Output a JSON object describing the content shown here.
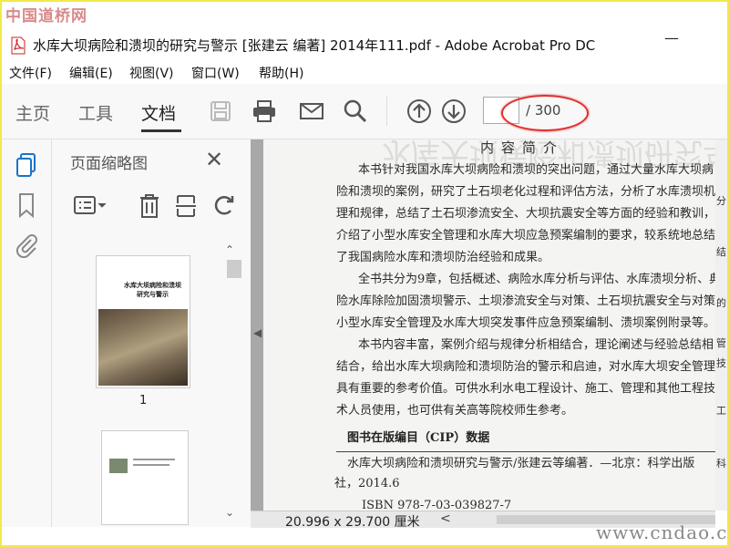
{
  "watermark_top": "中国道桥网",
  "watermark_bottom": "www.cndao.com",
  "window": {
    "title": "水库大坝病险和溃坝的研究与警示 [张建云 编著] 2014年111.pdf - Adobe Acrobat Pro DC",
    "minimize": "—"
  },
  "menu": [
    "文件(F)",
    "编辑(E)",
    "视图(V)",
    "窗口(W)",
    "帮助(H)"
  ],
  "tabs": [
    "主页",
    "工具",
    "文档"
  ],
  "active_tab": "文档",
  "page_nav": {
    "current": "",
    "total": "/ 300"
  },
  "thumbnail_panel": {
    "title": "页面缩略图",
    "close": "✕",
    "page1_label": "1",
    "page1_cover_title": "水库大坝病险和溃坝\n研究与警示"
  },
  "document": {
    "ghost_header": "水库大坝病险和溃坝研究与警示",
    "section_title": "内容简介",
    "paragraphs": [
      "本书针对我国水库大坝病险和溃坝的突出问题，通过大量水库大坝病",
      "险和溃坝的案例，研究了土石坝老化过程和评估方法，分析了水库溃坝机",
      "理和规律，总结了土石坝渗流安全、大坝抗震安全等方面的经验和教训，",
      "介绍了小型水库安全管理和水库大坝应急预案编制的要求，较系统地总结",
      "了我国病险水库和溃坝防治经验和成果。",
      "全书共分为9章，包括概述、病险水库分析与评估、水库溃坝分析、典",
      "险水库除险加固溃坝警示、土坝渗流安全与对策、土石坝抗震安全与对策、",
      "小型水库安全管理及水库大坝突发事件应急预案编制、溃坝案例附录等。",
      "本书内容丰富，案例介绍与规律分析相结合，理论阐述与经验总结相",
      "结合，给出水库大坝病险和溃坝防治的警示和启迪，对水库大坝安全管理",
      "具有重要的参考价值。可供水利水电工程设计、施工、管理和其他工程技",
      "术人员使用，也可供有关高等院校师生参考。"
    ],
    "cip_heading": "图书在版编目（CIP）数据",
    "cip_lines": [
      "水库大坝病险和溃坝研究与警示/张建云等编著．—北京：科学出版",
      "社，2014.6",
      "ISBN 978-7-03-039827-7"
    ],
    "right_edge_chars": [
      "分",
      "结",
      "的",
      "管",
      "技",
      "工",
      "科"
    ]
  },
  "status": {
    "dimensions": "20.996 x 29.700 厘米",
    "nav_left": "<"
  },
  "colors": {
    "annotation_red": "#e03030",
    "watermark_yellow": "#f2e94a"
  }
}
